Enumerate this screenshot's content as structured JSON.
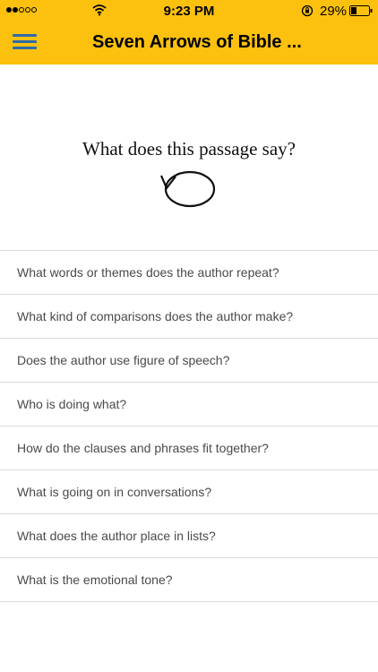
{
  "status_bar": {
    "time": "9:23 PM",
    "battery_percent": "29%",
    "signal_bars_filled": 2,
    "signal_bars_total": 5
  },
  "nav": {
    "title": "Seven Arrows of Bible ...",
    "menu_icon": "hamburger-menu-icon",
    "background_color": "#FCC10F",
    "icon_color": "#2F6BA8"
  },
  "hero": {
    "heading": "What does this passage say?",
    "icon": "circular-arrow-icon"
  },
  "questions": [
    "What words or themes does the author repeat?",
    "What kind of comparisons does the author make?",
    "Does the author use figure of speech?",
    "Who is doing what?",
    "How do the clauses and phrases fit together?",
    "What is going on in conversations?",
    "What does the author place in lists?",
    "What is the emotional tone?"
  ]
}
